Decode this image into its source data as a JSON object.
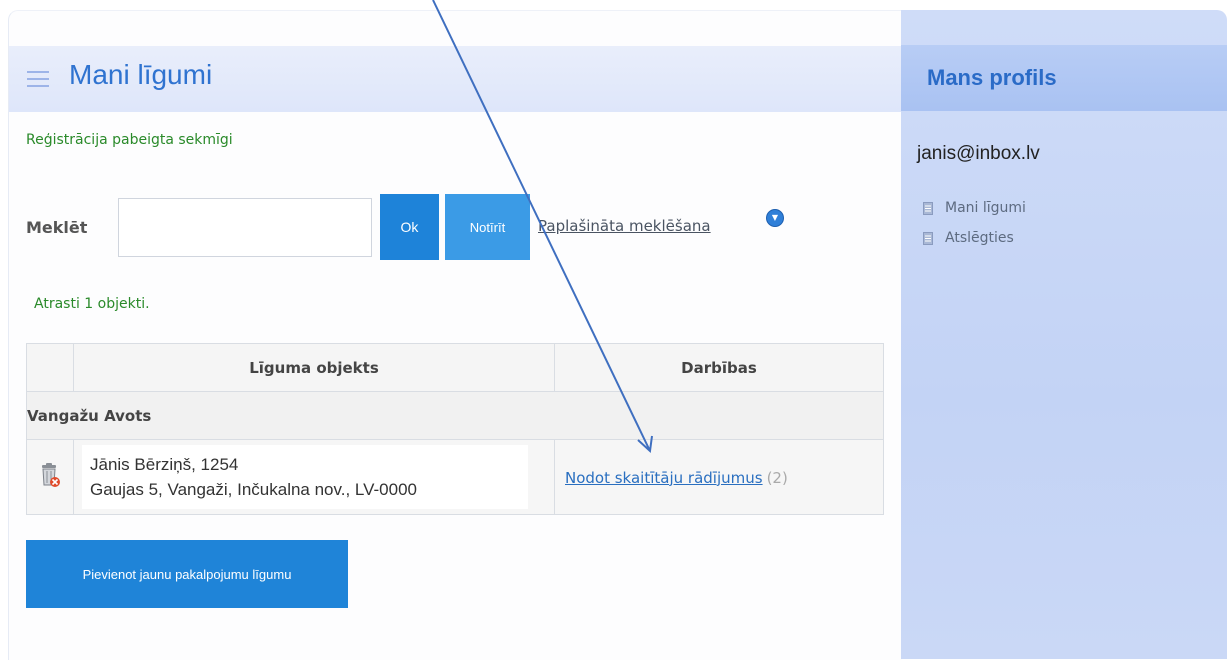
{
  "main": {
    "title": "Mani līgumi",
    "status_message": "Reģistrācija pabeigta sekmīgi",
    "search": {
      "label": "Meklēt",
      "input_value": "",
      "ok_label": "Ok",
      "clear_label": "Notīrīt",
      "advanced_label": "Paplašināta meklēšana"
    },
    "found_message": "Atrasti 1 objekti.",
    "table": {
      "columns": [
        "",
        "Līguma objekts",
        "Darbības"
      ],
      "group": "Vangažu Avots",
      "rows": [
        {
          "line1": "Jānis Bērziņš, 1254",
          "line2": "Gaujas 5, Vangaži, Inčukalna nov., LV-0000",
          "action_label": "Nodot skaitītāju rādījumus",
          "action_count": "(2)"
        }
      ]
    },
    "add_contract_label": "Pievienot jaunu pakalpojumu līgumu"
  },
  "sidebar": {
    "title": "Mans profils",
    "email": "janis@inbox.lv",
    "items": [
      {
        "label": "Mani līgumi",
        "icon": "document-icon"
      },
      {
        "label": "Atslēgties",
        "icon": "document-icon"
      }
    ]
  },
  "colors": {
    "accent": "#1e83d9",
    "title_blue": "#2f73d0",
    "success_green": "#2a8a2a",
    "link_blue": "#2a6fc0",
    "sidebar_bg": "#c8d6f6",
    "annotation_arrow": "#3f6fc0"
  }
}
